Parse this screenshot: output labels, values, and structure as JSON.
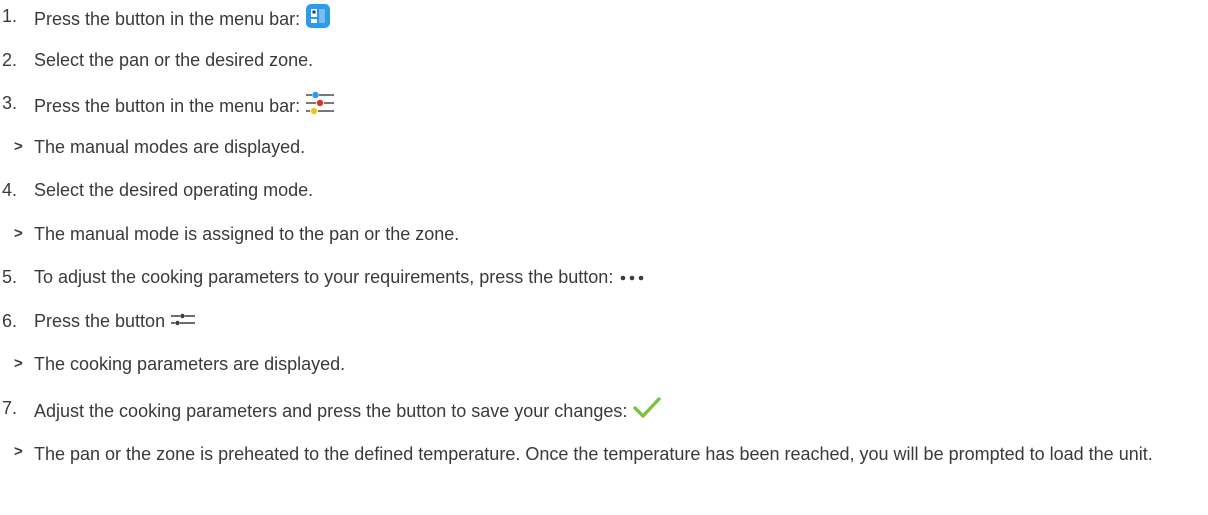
{
  "steps": [
    {
      "kind": "step",
      "num": "1.",
      "text": "Press the button in the menu bar:",
      "icon": "pan-zone-icon"
    },
    {
      "kind": "step",
      "num": "2.",
      "text": "Select the pan or the desired zone."
    },
    {
      "kind": "step",
      "num": "3.",
      "text": "Press the button in the menu bar:",
      "icon": "manual-modes-sliders-icon"
    },
    {
      "kind": "result",
      "num": ">",
      "text": "The manual modes are displayed."
    },
    {
      "kind": "step",
      "num": "4.",
      "text": "Select the desired operating mode."
    },
    {
      "kind": "result",
      "num": ">",
      "text": "The manual mode is assigned to the pan or the zone."
    },
    {
      "kind": "step",
      "num": "5.",
      "text": "To adjust the cooking parameters to your requirements, press the button:",
      "icon": "more-dots-icon"
    },
    {
      "kind": "step",
      "num": "6.",
      "text": "Press the button",
      "icon": "cooking-parameters-icon"
    },
    {
      "kind": "result",
      "num": ">",
      "text": "The cooking parameters are displayed."
    },
    {
      "kind": "step",
      "num": "7.",
      "text": "Adjust the cooking parameters and press the button to save your changes:",
      "icon": "checkmark-icon"
    },
    {
      "kind": "result",
      "num": ">",
      "text": "The pan or the zone is preheated to the defined temperature. Once the temperature has been reached, you will be prompted to load the unit."
    }
  ],
  "colors": {
    "text": "#3a3a3a",
    "icon_blue": "#2d9be8",
    "icon_red": "#e0312d",
    "icon_yellow": "#f4c21c",
    "check_green": "#7bc143"
  }
}
